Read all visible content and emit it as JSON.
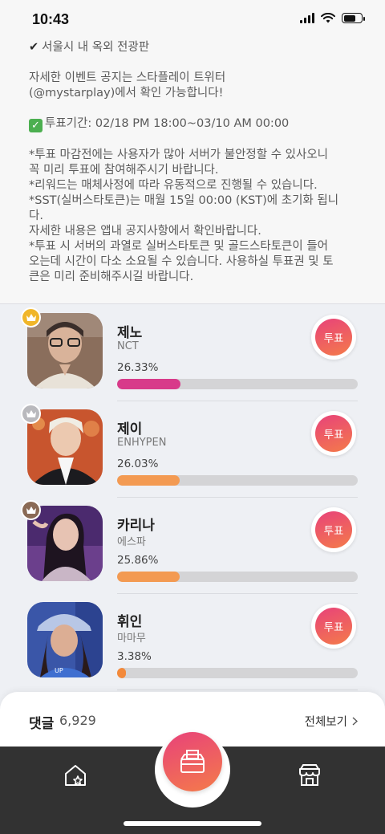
{
  "status_bar": {
    "time": "10:43"
  },
  "notice": {
    "line_location": "서울시 내 옥외 전광판",
    "line_detail": "자세한 이벤트 공지는 스타플레이 트위터\n(@mystarplay)에서 확인 가능합니다!",
    "line_period": "투표기간: 02/18 PM 18:00~03/10 AM 00:00",
    "line_notes": "*투표 마감전에는 사용자가 많아 서버가 불안정할 수 있사오니\n꼭 미리 투표에 참여해주시기 바랍니다.\n*리워드는 매체사정에 따라 유동적으로 진행될 수 있습니다.\n*SST(실버스타토큰)는 매월 15일 00:00 (KST)에 초기화 됩니\n다.\n자세한 내용은 앱내 공지사항에서 확인바랍니다.\n*투표 시 서버의 과열로 실버스타토큰 및 골드스타토큰이 들어\n오는데 시간이 다소 소요될 수 있습니다. 사용하실 투표권 및 토\n큰은 미리 준비해주시길 바랍니다."
  },
  "ranking": [
    {
      "rank": 1,
      "name": "제노",
      "group": "NCT",
      "percent_label": "26.33%",
      "share": 0.2633,
      "bar_color": "#d83a8a",
      "crown": "gold",
      "vote_label": "투표"
    },
    {
      "rank": 2,
      "name": "제이",
      "group": "ENHYPEN",
      "percent_label": "26.03%",
      "share": 0.2603,
      "bar_color": "#f39a52",
      "crown": "silver",
      "vote_label": "투표"
    },
    {
      "rank": 3,
      "name": "카리나",
      "group": "에스파",
      "percent_label": "25.86%",
      "share": 0.2586,
      "bar_color": "#f39a52",
      "crown": "bronze",
      "vote_label": "투표"
    },
    {
      "rank": 4,
      "name": "휘인",
      "group": "마마무",
      "percent_label": "3.38%",
      "share": 0.0338,
      "bar_color": "#f3893a",
      "crown": "none",
      "vote_label": "투표"
    }
  ],
  "comments": {
    "label": "댓글",
    "count": "6,929",
    "view_all": "전체보기"
  },
  "colors": {
    "accent_start": "#e8427a",
    "accent_end": "#f47b4a",
    "nav_bg": "#323232"
  }
}
